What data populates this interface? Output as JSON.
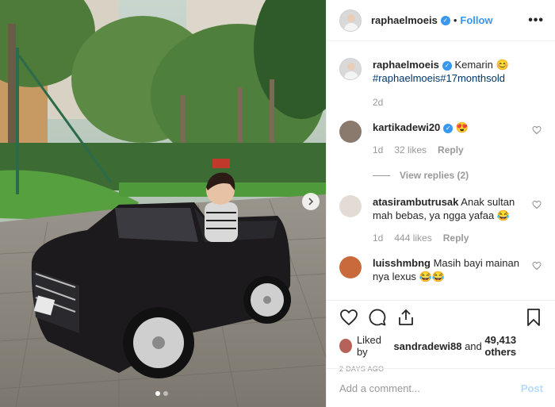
{
  "post": {
    "username": "raphaelmoeis",
    "separator": "•",
    "follow_label": "Follow",
    "more_label": "•••",
    "caption_text": "Kemarin 😊",
    "caption_hashtags": "#raphaelmoeis#17monthsold",
    "caption_time": "2d"
  },
  "comments": [
    {
      "username": "kartikadewi20",
      "text": "😍",
      "time": "1d",
      "likes": "32 likes",
      "reply_label": "Reply",
      "view_replies": "View replies (2)"
    },
    {
      "username": "atasirambutrusak",
      "text": "Anak sultan mah bebas, ya ngga yafaa 😂",
      "time": "1d",
      "likes": "444 likes",
      "reply_label": "Reply"
    },
    {
      "username": "luisshmbng",
      "text": "Masih bayi mainan nya lexus 😂😂"
    }
  ],
  "likes": {
    "prefix": "Liked by ",
    "liked_by": "sandradewi88",
    "middle": " and ",
    "others": "49,413 others"
  },
  "date_label": "2 DAYS AGO",
  "comment_input": {
    "placeholder": "Add a comment...",
    "post_label": "Post"
  },
  "icons": [
    "heart-icon",
    "comment-icon",
    "share-icon",
    "bookmark-icon",
    "chevron-right-icon",
    "verified-badge-icon"
  ],
  "colors": {
    "accent": "#3897f0",
    "muted": "#999999",
    "border": "#efefef",
    "post_disabled": "#b3dbff"
  }
}
